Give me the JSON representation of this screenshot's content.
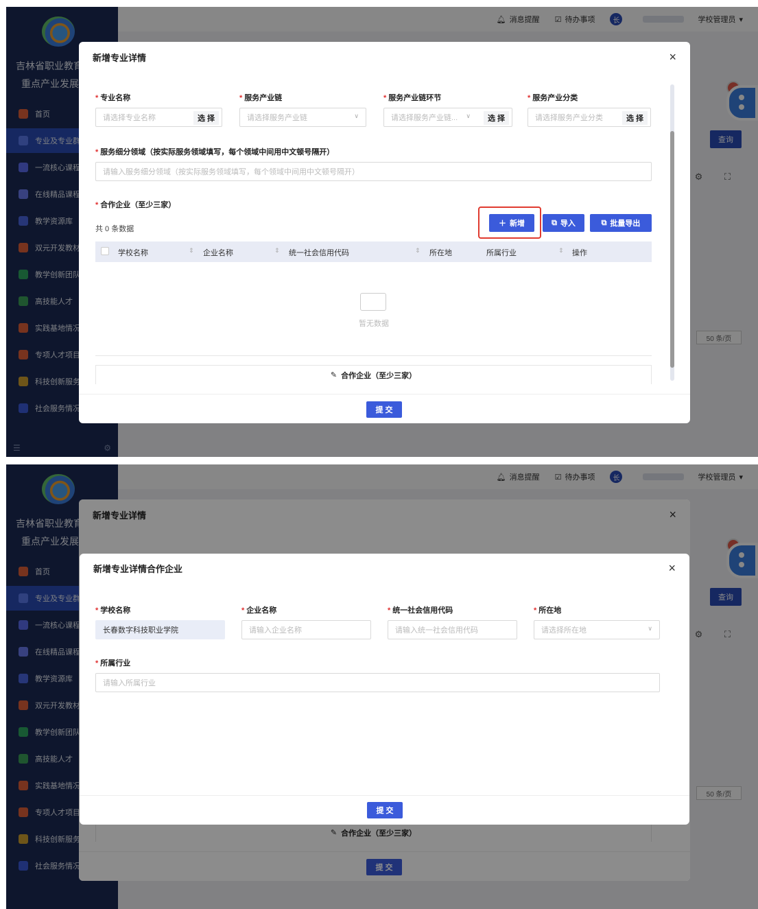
{
  "app": {
    "title_line1": "吉林省职业教育",
    "title_line2": "重点产业发展",
    "menu": [
      "首页",
      "专业及专业群",
      "一流核心课程",
      "在线精品课程",
      "教学资源库",
      "双元开发教材",
      "教学创新团队",
      "高技能人才",
      "实践基地情况",
      "专项人才项目",
      "科技创新服务",
      "社会服务情况"
    ],
    "menu_colors": [
      "#e0603a",
      "#3b5bdb",
      "#5b6cf0",
      "#6b7cf0",
      "#4a67e0",
      "#e0603a",
      "#2fa860",
      "#3ca05a",
      "#e0603a",
      "#e0603a",
      "#d0a030",
      "#3b5bdb"
    ],
    "topbar": {
      "notify": "消息提醒",
      "todo": "待办事项",
      "avatar": "长",
      "user": "学校管理员"
    },
    "query_btn": "查询",
    "pager": "50 条/页"
  },
  "modal1": {
    "title": "新增专业详情",
    "close": "×",
    "fields": {
      "major": {
        "label": "专业名称",
        "placeholder": "请选择专业名称",
        "btn": "选 择"
      },
      "chain": {
        "label": "服务产业链",
        "placeholder": "请选择服务产业链"
      },
      "link": {
        "label": "服务产业链环节",
        "placeholder": "请选择服务产业链...",
        "btn": "选 择"
      },
      "category": {
        "label": "服务产业分类",
        "placeholder": "请选择服务产业分类",
        "btn": "选 择"
      },
      "domain": {
        "label": "服务细分领域（按实际服务领域填写，每个领域中间用中文顿号隔开）",
        "placeholder": "请输入服务细分领域（按实际服务领域填写，每个领域中间用中文顿号隔开）"
      }
    },
    "partners_label": "合作企业（至少三家）",
    "count": "共 0 条数据",
    "add_btn": "新增",
    "import_btn": "导入",
    "export_btn": "批量导出",
    "columns": [
      "学校名称",
      "企业名称",
      "统一社会信用代码",
      "所在地",
      "所属行业",
      "操作"
    ],
    "empty": "暂无数据",
    "section_footer": "合作企业（至少三家）",
    "submit": "提 交"
  },
  "modal2": {
    "title": "新增专业详情合作企业",
    "close": "×",
    "fields": {
      "school": {
        "label": "学校名称",
        "value": "长春数字科技职业学院"
      },
      "company": {
        "label": "企业名称",
        "placeholder": "请输入企业名称"
      },
      "credit": {
        "label": "统一社会信用代码",
        "placeholder": "请输入统一社会信用代码"
      },
      "location": {
        "label": "所在地",
        "placeholder": "请选择所在地"
      },
      "industry": {
        "label": "所属行业",
        "placeholder": "请输入所属行业"
      }
    },
    "submit": "提 交"
  }
}
